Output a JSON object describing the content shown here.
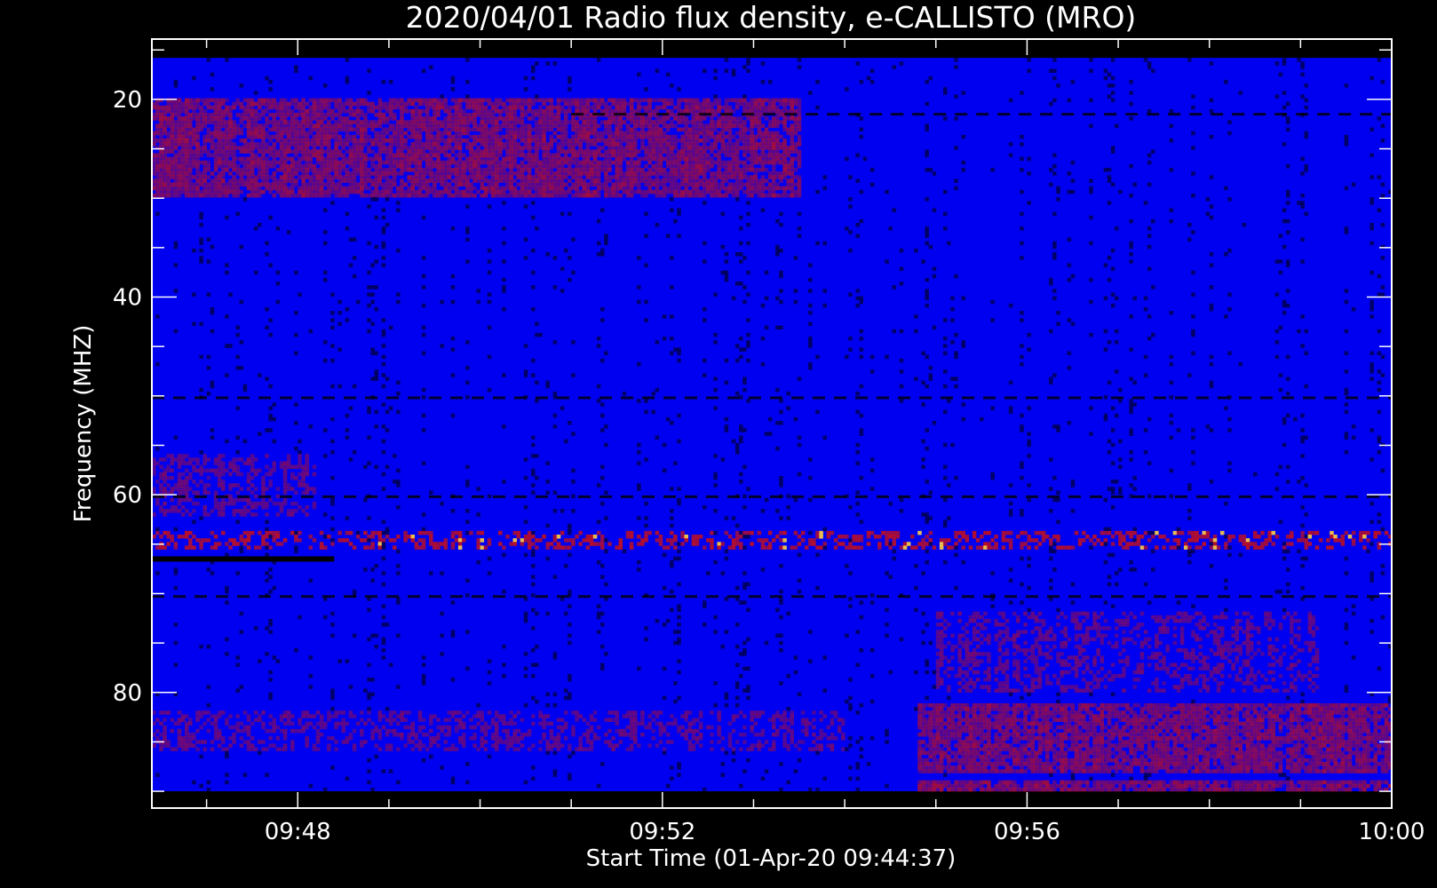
{
  "chart_data": {
    "type": "heatmap",
    "title": "2020/04/01  Radio flux density, e-CALLISTO (MRO)",
    "xlabel": "Start Time (01-Apr-20 09:44:37)",
    "ylabel": "Frequency (MHZ)",
    "x_range_minutes": [
      46.4,
      60.0
    ],
    "x_data_minutes": [
      46.4,
      60.0
    ],
    "y_range_mhz": [
      13.9,
      91.7
    ],
    "y_data_mhz": [
      15.8,
      90.0
    ],
    "y_inverted": true,
    "x_ticks": [
      {
        "minute": 48,
        "label": "09:48"
      },
      {
        "minute": 52,
        "label": "09:52"
      },
      {
        "minute": 56,
        "label": "09:56"
      },
      {
        "minute": 60,
        "label": "10:00"
      }
    ],
    "x_minor_step": 1,
    "y_ticks": [
      {
        "value": 20,
        "label": "20"
      },
      {
        "value": 40,
        "label": "40"
      },
      {
        "value": 60,
        "label": "60"
      },
      {
        "value": 80,
        "label": "80"
      }
    ],
    "y_minor_step": 5,
    "colors": {
      "background": "#0000f0",
      "high": "#cc1010",
      "peak": "#ffd040",
      "low": "#000000",
      "frame": "#ffffff"
    },
    "features": [
      {
        "name": "band",
        "f0": 20,
        "f1": 30,
        "t0": 46.4,
        "t1": 53.5,
        "strength": 0.55
      },
      {
        "name": "band",
        "f0": 56,
        "f1": 62,
        "t0": 46.4,
        "t1": 48.2,
        "strength": 0.35
      },
      {
        "name": "band",
        "f0": 72,
        "f1": 80,
        "t0": 55.0,
        "t1": 59.2,
        "strength": 0.35
      },
      {
        "name": "band",
        "f0": 81,
        "f1": 88,
        "t0": 54.8,
        "t1": 60.0,
        "strength": 0.55
      },
      {
        "name": "band",
        "f0": 82,
        "f1": 86,
        "t0": 46.4,
        "t1": 54.0,
        "strength": 0.35
      },
      {
        "name": "band",
        "f0": 89,
        "f1": 90,
        "t0": 54.8,
        "t1": 60.0,
        "strength": 0.6
      },
      {
        "name": "burst-line",
        "f0": 63.5,
        "f1": 65.5,
        "t0": 46.4,
        "t1": 60.0,
        "strength": 0.7
      },
      {
        "name": "gap-line",
        "f": 70.3,
        "t0": 46.4,
        "t1": 60.0
      },
      {
        "name": "gap-line",
        "f": 60.2,
        "t0": 46.4,
        "t1": 60.0
      },
      {
        "name": "gap-line",
        "f": 50.2,
        "t0": 46.4,
        "t1": 60.0
      },
      {
        "name": "gap-line",
        "f": 21.5,
        "t0": 51.0,
        "t1": 60.0
      },
      {
        "name": "marker",
        "f": 66.5,
        "t0": 46.4,
        "t1": 48.4
      }
    ]
  }
}
